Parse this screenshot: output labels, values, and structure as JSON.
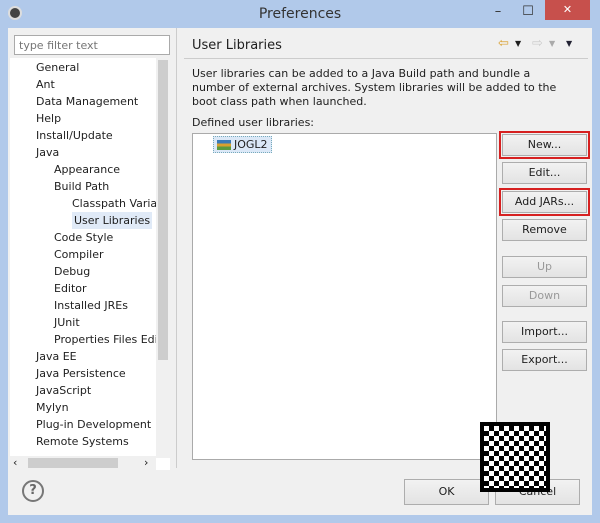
{
  "window": {
    "title": "Preferences",
    "icons": {
      "app": "eclipse-gear-icon",
      "minimize": "minimize-icon",
      "maximize": "maximize-icon",
      "close": "close-icon"
    }
  },
  "filter": {
    "placeholder": "type filter text"
  },
  "tree": [
    {
      "label": "General",
      "level": 0
    },
    {
      "label": "Ant",
      "level": 0
    },
    {
      "label": "Data Management",
      "level": 0
    },
    {
      "label": "Help",
      "level": 0
    },
    {
      "label": "Install/Update",
      "level": 0
    },
    {
      "label": "Java",
      "level": 0
    },
    {
      "label": "Appearance",
      "level": 1
    },
    {
      "label": "Build Path",
      "level": 1
    },
    {
      "label": "Classpath Variab",
      "level": 2
    },
    {
      "label": "User Libraries",
      "level": 2,
      "selected": true
    },
    {
      "label": "Code Style",
      "level": 1
    },
    {
      "label": "Compiler",
      "level": 1
    },
    {
      "label": "Debug",
      "level": 1
    },
    {
      "label": "Editor",
      "level": 1
    },
    {
      "label": "Installed JREs",
      "level": 1
    },
    {
      "label": "JUnit",
      "level": 1
    },
    {
      "label": "Properties Files Edito",
      "level": 1
    },
    {
      "label": "Java EE",
      "level": 0
    },
    {
      "label": "Java Persistence",
      "level": 0
    },
    {
      "label": "JavaScript",
      "level": 0
    },
    {
      "label": "Mylyn",
      "level": 0
    },
    {
      "label": "Plug-in Development",
      "level": 0
    },
    {
      "label": "Remote Systems",
      "level": 0
    }
  ],
  "page": {
    "title": "User Libraries",
    "description": "User libraries can be added to a Java Build path and bundle a number of external archives. System libraries will be added to the boot class path when launched.",
    "defined_label": "Defined user libraries:",
    "libraries": [
      "JOGL2"
    ]
  },
  "buttons": {
    "new": "New...",
    "edit": "Edit...",
    "add_jars": "Add JARs...",
    "remove": "Remove",
    "up": "Up",
    "down": "Down",
    "import": "Import...",
    "export": "Export..."
  },
  "footer": {
    "ok": "OK",
    "cancel": "Cancel",
    "help": "?"
  },
  "colors": {
    "highlight": "#d62020",
    "window_frame": "#b1c9ea"
  }
}
